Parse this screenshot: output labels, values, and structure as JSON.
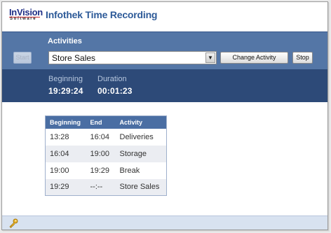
{
  "header": {
    "logo_main": "InVision",
    "logo_sub": "Software",
    "title": "Infothek Time Recording"
  },
  "activities": {
    "title": "Activities",
    "start_label": "Start",
    "selected": "Store Sales",
    "change_label": "Change Activity",
    "stop_label": "Stop"
  },
  "timer": {
    "beginning_label": "Beginning",
    "beginning_value": "19:29:24",
    "duration_label": "Duration",
    "duration_value": "00:01:23"
  },
  "log": {
    "columns": [
      "Beginning",
      "End",
      "Activity"
    ],
    "rows": [
      [
        "13:28",
        "16:04",
        "Deliveries"
      ],
      [
        "16:04",
        "19:00",
        "Storage"
      ],
      [
        "19:00",
        "19:29",
        "Break"
      ],
      [
        "19:29",
        "--:--",
        "Store Sales"
      ]
    ]
  },
  "footer": {
    "icon": "key-icon"
  },
  "colors": {
    "panel": "#5476a6",
    "timebar": "#2d4a78",
    "table_header": "#4a6ea3",
    "title": "#2d5a98"
  }
}
